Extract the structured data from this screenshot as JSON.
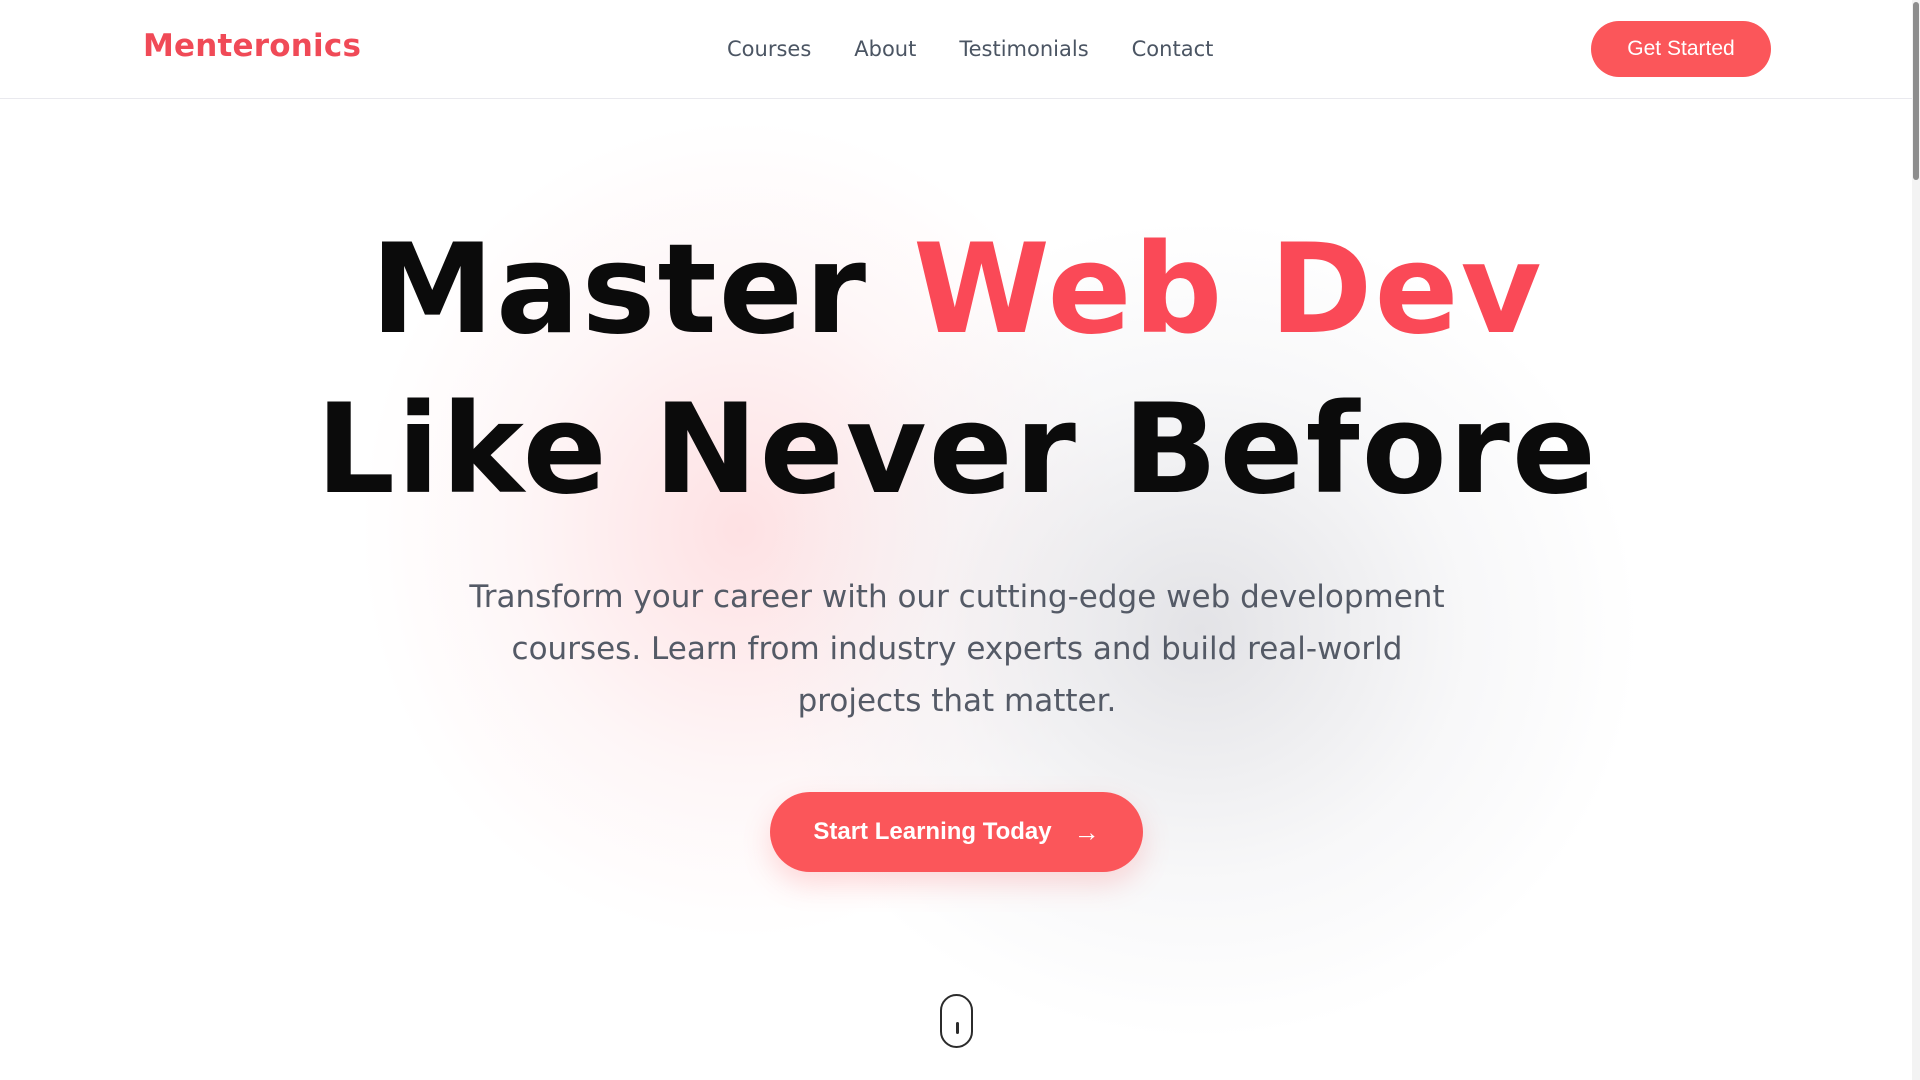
{
  "brand": {
    "name": "Menteronics"
  },
  "nav": {
    "items": [
      {
        "label": "Courses"
      },
      {
        "label": "About"
      },
      {
        "label": "Testimonials"
      },
      {
        "label": "Contact"
      }
    ],
    "cta_label": "Get Started"
  },
  "hero": {
    "headline_part1": "Master ",
    "headline_accent": "Web Dev",
    "headline_line2": "Like Never Before",
    "subtext": "Transform your career with our cutting-edge web development courses. Learn from industry experts and build real-world projects that matter.",
    "cta_label": "Start Learning Today",
    "cta_icon": "arrow-right-icon"
  },
  "scroll_indicator": {
    "icon": "mouse-scroll-icon"
  },
  "colors": {
    "accent": "#fa4957",
    "button": "#fb565a",
    "text_dark": "#0b0b0b",
    "text_muted": "#545a66",
    "nav_text": "#4b5563"
  }
}
